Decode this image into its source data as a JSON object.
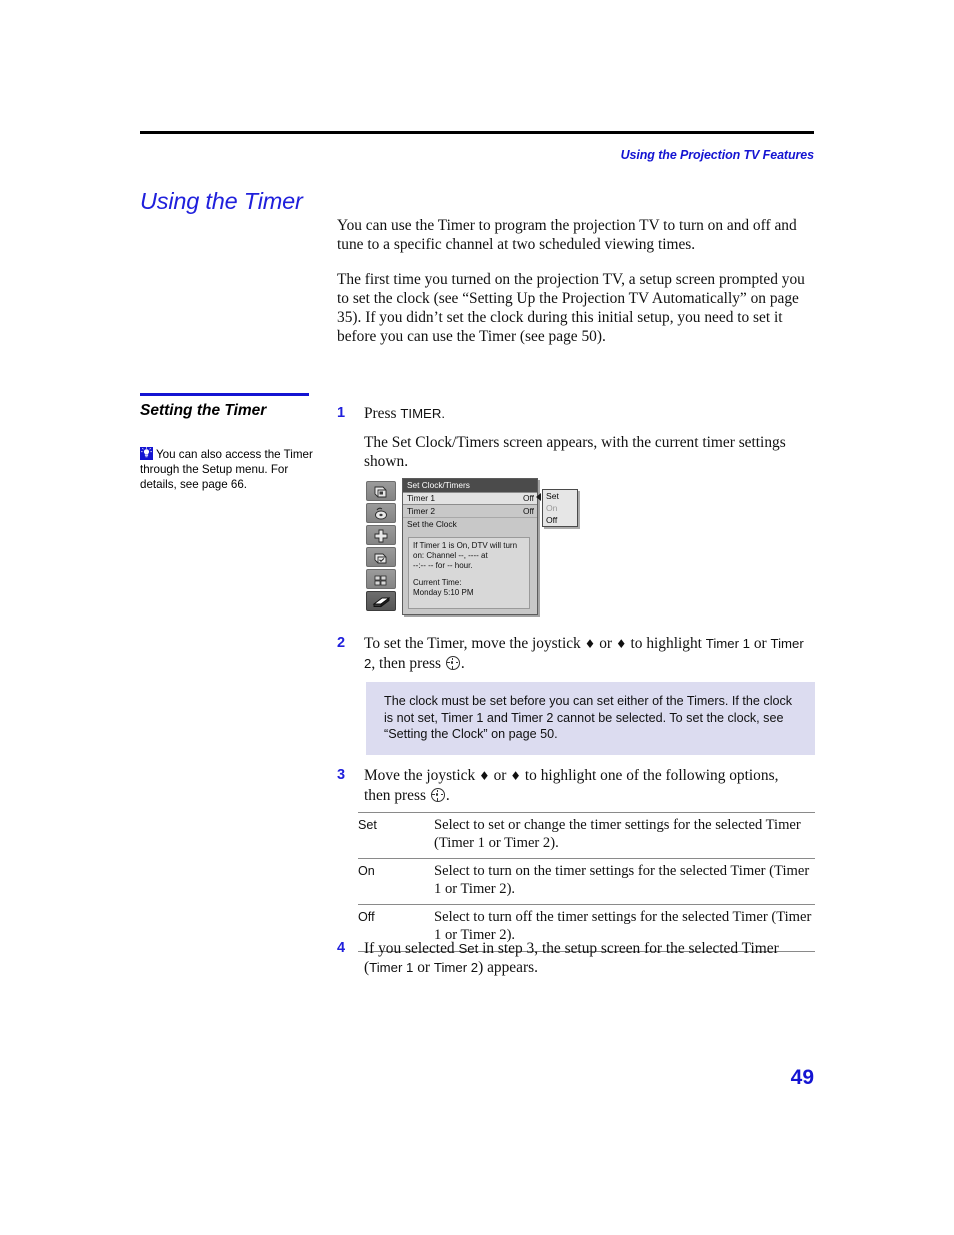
{
  "header": {
    "running_head": "Using the Projection TV Features"
  },
  "page_title": "Using the Timer",
  "intro": {
    "para1": "You can use the Timer to program the projection TV to turn on and off and tune to a specific channel at two scheduled viewing times.",
    "para2": "The first time you turned on the projection TV, a setup screen prompted you to set the clock (see “Setting Up the Projection TV Automatically” on page 35). If you didn’t set the clock during this initial setup, you need to set it before you can use the Timer (see page 50)."
  },
  "sidebar": {
    "section_title": "Setting the Timer",
    "tip_icon": "lightbulb-icon",
    "tip_text": "You can also access the Timer through the Setup menu. For details, see page 66."
  },
  "steps": [
    {
      "number": "1",
      "line1": "Press TIMER.",
      "line2": "The Set Clock/Timers screen appears, with the current timer settings shown."
    },
    {
      "number": "2",
      "text_a": "To set the Timer, move the joystick ",
      "up": "♦",
      "text_b": " or ",
      "down": "♦",
      "text_c": " to highlight Timer 1 or Timer 2, then press ",
      "text_d": "."
    },
    {
      "number": "3",
      "text_a": "Move the joystick ",
      "text_b": " or ",
      "text_c": " to highlight one of the following options, then press ",
      "text_d": "."
    },
    {
      "number": "4",
      "text": "If you selected Set in step 3, the setup screen for the selected Timer (Timer 1 or Timer 2) appears."
    }
  ],
  "tv_screen": {
    "title": "Set Clock/Timers",
    "rows": [
      {
        "label": "Timer 1",
        "value": "Off",
        "highlighted": true
      },
      {
        "label": "Timer 2",
        "value": "Off",
        "highlighted": false
      },
      {
        "label": "Set the Clock",
        "value": "",
        "highlighted": false
      }
    ],
    "info_line1": "If Timer 1 is On, DTV will turn",
    "info_line2": "on: Channel --, ---- at",
    "info_line3": "--:-- -- for -- hour.",
    "info_line4": "Current Time:",
    "info_line5": "Monday 5:10 PM",
    "submenu": [
      {
        "label": "Set",
        "dimmed": false
      },
      {
        "label": "On",
        "dimmed": true
      },
      {
        "label": "Off",
        "dimmed": false
      }
    ],
    "icons": [
      "video-input-icon",
      "audio-icon",
      "picture-icon",
      "channel-icon",
      "parental-icon",
      "setup-icon"
    ]
  },
  "note": {
    "text": "The clock must be set before you can set either of the Timers. If the clock is not set, Timer 1 and Timer 2 cannot be selected. To set the clock, see “Setting the Clock” on page 50."
  },
  "options_table": {
    "rows": [
      {
        "key": "Set",
        "value": "Select to set or change the timer settings for the selected Timer (Timer 1 or Timer 2)."
      },
      {
        "key": "On",
        "value": "Select to turn on the timer settings for the selected Timer (Timer 1 or Timer 2)."
      },
      {
        "key": "Off",
        "value": "Select to turn off the timer settings for the selected Timer (Timer 1 or Timer 2)."
      }
    ]
  },
  "folio": "49",
  "colors": {
    "accent_blue": "#1414d2",
    "title_blue": "#2020dc",
    "note_bg": "#dcdcf0"
  }
}
